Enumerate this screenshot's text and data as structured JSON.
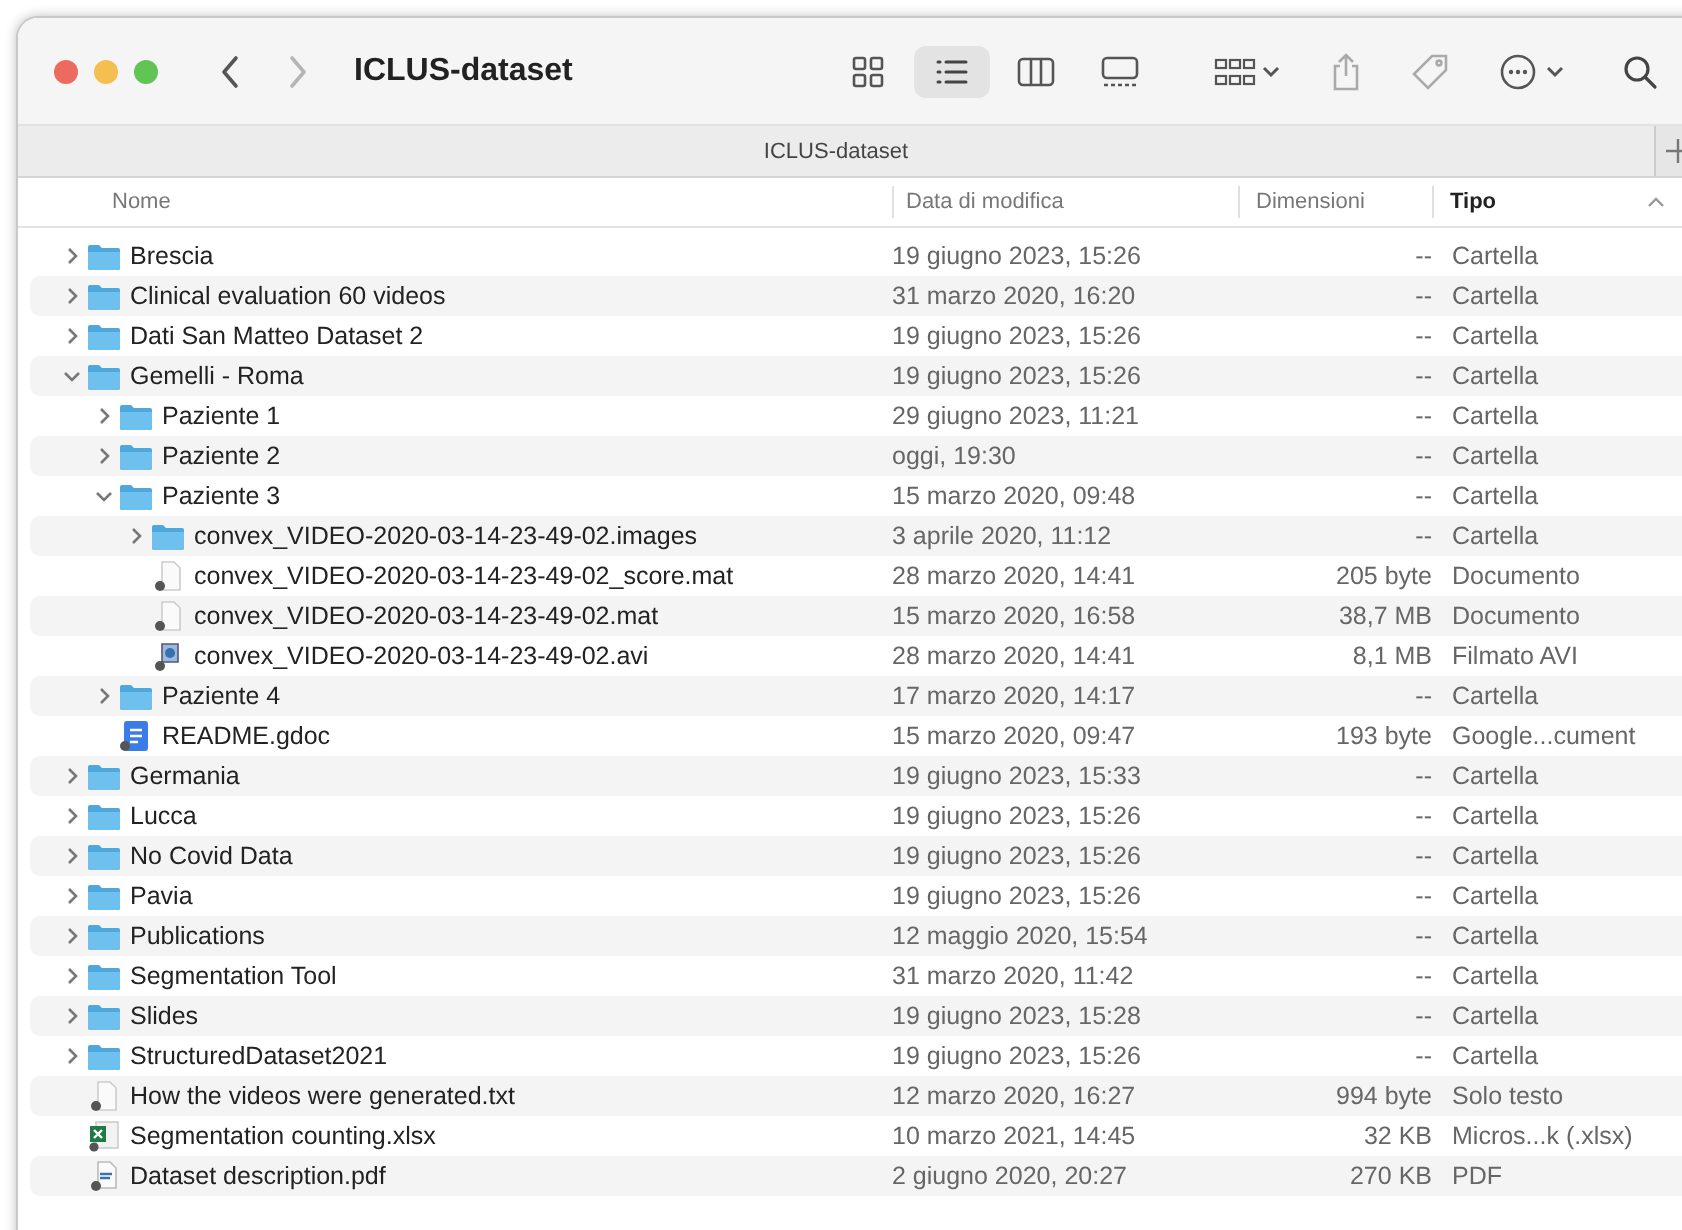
{
  "window": {
    "title": "ICLUS-dataset"
  },
  "toolbar": {
    "back_disabled": false,
    "forward_disabled": true,
    "views": [
      {
        "kind": "icons",
        "selected": false
      },
      {
        "kind": "list",
        "selected": true
      },
      {
        "kind": "columns",
        "selected": false
      },
      {
        "kind": "gallery",
        "selected": false
      }
    ]
  },
  "tabs": [
    {
      "label": "ICLUS-dataset",
      "selected": true
    }
  ],
  "columns": [
    {
      "label": "Nome",
      "sorted": false
    },
    {
      "label": "Data di modifica",
      "sorted": false
    },
    {
      "label": "Dimensioni",
      "sorted": false
    },
    {
      "label": "Tipo",
      "sorted": true
    }
  ],
  "items": [
    {
      "name": "Brescia",
      "kind": "folder",
      "expanded": false,
      "date": "19 giugno 2023, 15:26",
      "size": "--",
      "type": "Cartella"
    },
    {
      "name": "Clinical evaluation 60 videos",
      "kind": "folder",
      "expanded": false,
      "date": "31 marzo 2020, 16:20",
      "size": "--",
      "type": "Cartella"
    },
    {
      "name": "Dati San Matteo Dataset 2",
      "kind": "folder",
      "expanded": false,
      "date": "19 giugno 2023, 15:26",
      "size": "--",
      "type": "Cartella"
    },
    {
      "name": "Gemelli - Roma",
      "kind": "folder",
      "expanded": true,
      "date": "19 giugno 2023, 15:26",
      "size": "--",
      "type": "Cartella",
      "children": [
        {
          "name": "Paziente 1",
          "kind": "folder",
          "expanded": false,
          "date": "29 giugno 2023, 11:21",
          "size": "--",
          "type": "Cartella"
        },
        {
          "name": "Paziente 2",
          "kind": "folder",
          "expanded": false,
          "date": "oggi, 19:30",
          "size": "--",
          "type": "Cartella"
        },
        {
          "name": "Paziente 3",
          "kind": "folder",
          "expanded": true,
          "date": "15 marzo 2020, 09:48",
          "size": "--",
          "type": "Cartella",
          "children": [
            {
              "name": "convex_VIDEO-2020-03-14-23-49-02.images",
              "kind": "folder",
              "expanded": false,
              "date": "3 aprile 2020, 11:12",
              "size": "--",
              "type": "Cartella"
            },
            {
              "name": "convex_VIDEO-2020-03-14-23-49-02_score.mat",
              "kind": "doc",
              "date": "28 marzo 2020, 14:41",
              "size": "205 byte",
              "type": "Documento"
            },
            {
              "name": "convex_VIDEO-2020-03-14-23-49-02.mat",
              "kind": "doc",
              "date": "15 marzo 2020, 16:58",
              "size": "38,7 MB",
              "type": "Documento"
            },
            {
              "name": "convex_VIDEO-2020-03-14-23-49-02.avi",
              "kind": "video",
              "date": "28 marzo 2020, 14:41",
              "size": "8,1 MB",
              "type": "Filmato AVI"
            }
          ]
        },
        {
          "name": "Paziente 4",
          "kind": "folder",
          "expanded": false,
          "date": "17 marzo 2020, 14:17",
          "size": "--",
          "type": "Cartella"
        },
        {
          "name": "README.gdoc",
          "kind": "gdoc",
          "date": "15 marzo 2020, 09:47",
          "size": "193 byte",
          "type": "Google...cument"
        }
      ]
    },
    {
      "name": "Germania",
      "kind": "folder",
      "expanded": false,
      "date": "19 giugno 2023, 15:33",
      "size": "--",
      "type": "Cartella"
    },
    {
      "name": "Lucca",
      "kind": "folder",
      "expanded": false,
      "date": "19 giugno 2023, 15:26",
      "size": "--",
      "type": "Cartella"
    },
    {
      "name": "No Covid Data",
      "kind": "folder",
      "expanded": false,
      "date": "19 giugno 2023, 15:26",
      "size": "--",
      "type": "Cartella"
    },
    {
      "name": "Pavia",
      "kind": "folder",
      "expanded": false,
      "date": "19 giugno 2023, 15:26",
      "size": "--",
      "type": "Cartella"
    },
    {
      "name": "Publications",
      "kind": "folder",
      "expanded": false,
      "date": "12 maggio 2020, 15:54",
      "size": "--",
      "type": "Cartella"
    },
    {
      "name": "Segmentation Tool",
      "kind": "folder",
      "expanded": false,
      "date": "31 marzo 2020, 11:42",
      "size": "--",
      "type": "Cartella"
    },
    {
      "name": "Slides",
      "kind": "folder",
      "expanded": false,
      "date": "19 giugno 2023, 15:28",
      "size": "--",
      "type": "Cartella"
    },
    {
      "name": "StructuredDataset2021",
      "kind": "folder",
      "expanded": false,
      "date": "19 giugno 2023, 15:26",
      "size": "--",
      "type": "Cartella"
    },
    {
      "name": "How the videos were generated.txt",
      "kind": "txt",
      "date": "12 marzo 2020, 16:27",
      "size": "994 byte",
      "type": "Solo testo"
    },
    {
      "name": "Segmentation counting.xlsx",
      "kind": "xlsx",
      "date": "10 marzo 2021, 14:45",
      "size": "32 KB",
      "type": "Micros...k (.xlsx)"
    },
    {
      "name": "Dataset description.pdf",
      "kind": "pdf",
      "date": "2 giugno 2020, 20:27",
      "size": "270 KB",
      "type": "PDF"
    }
  ]
}
